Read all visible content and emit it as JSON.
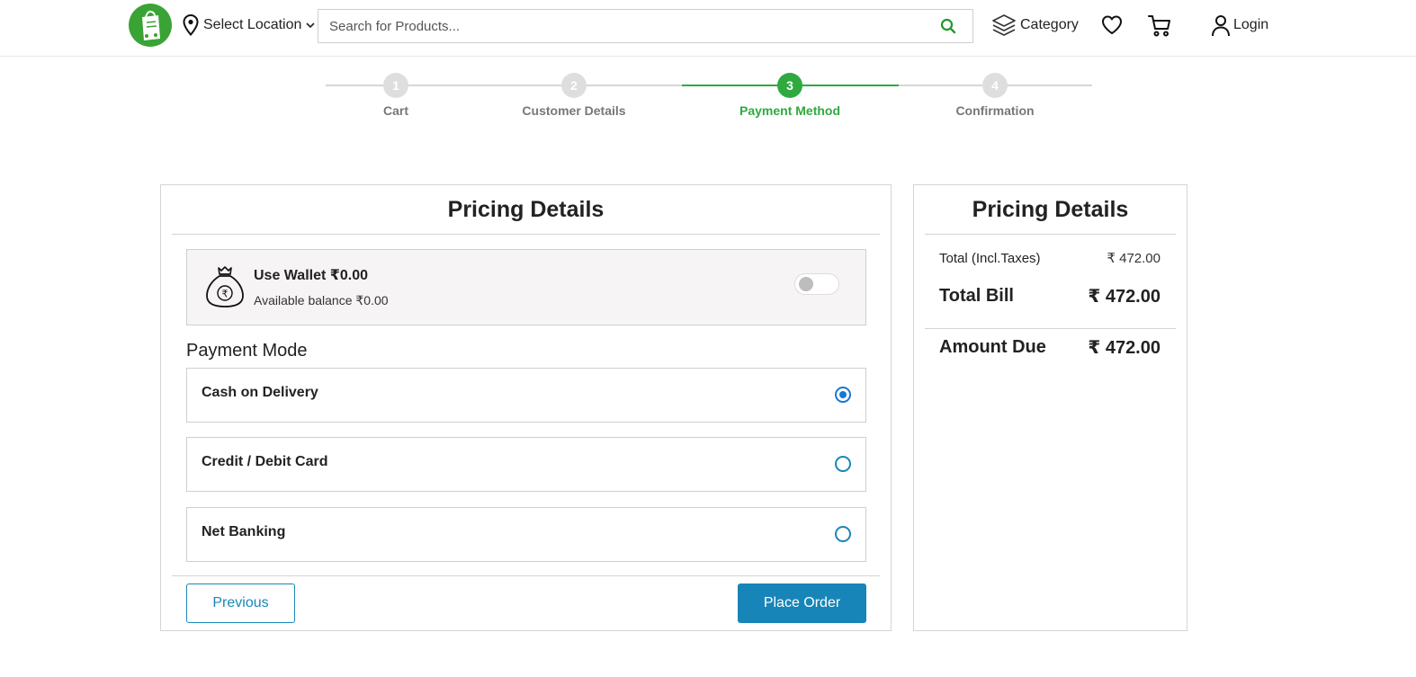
{
  "header": {
    "location_label": "Select Location",
    "search_placeholder": "Search for Products...",
    "category_label": "Category",
    "login_label": "Login"
  },
  "stepper": {
    "steps": [
      {
        "number": "1",
        "label": "Cart",
        "active": false
      },
      {
        "number": "2",
        "label": "Customer Details",
        "active": false
      },
      {
        "number": "3",
        "label": "Payment Method",
        "active": true
      },
      {
        "number": "4",
        "label": "Confirmation",
        "active": false
      }
    ]
  },
  "payment_card": {
    "title": "Pricing Details",
    "wallet": {
      "title": "Use Wallet ₹0.00",
      "balance": "Available balance ₹0.00",
      "enabled": false
    },
    "payment_mode_heading": "Payment Mode",
    "options": [
      {
        "label": "Cash on Delivery",
        "selected": true
      },
      {
        "label": "Credit / Debit Card",
        "selected": false
      },
      {
        "label": "Net Banking",
        "selected": false
      }
    ],
    "previous_label": "Previous",
    "place_order_label": "Place Order"
  },
  "summary_card": {
    "title": "Pricing Details",
    "total_label": "Total (Incl.Taxes)",
    "total_value": "₹ 472.00",
    "total_bill_label": "Total Bill",
    "total_bill_value": "₹ 472.00",
    "amount_due_label": "Amount Due",
    "amount_due_value": "₹ 472.00"
  },
  "colors": {
    "brand_green": "#3aa335",
    "active_step": "#2eaa3f",
    "primary_blue": "#1785b8",
    "radio_selected": "#1977d2"
  }
}
